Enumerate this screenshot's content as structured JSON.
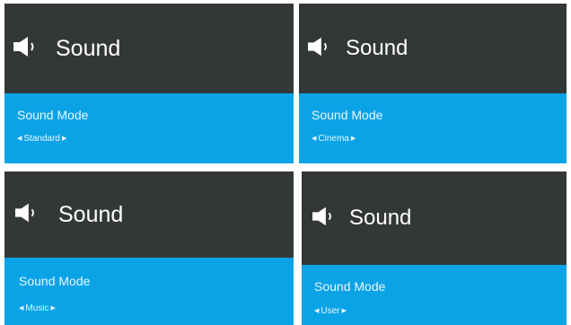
{
  "panels": [
    {
      "title": "Sound",
      "mode_label": "Sound Mode",
      "value": "Standard",
      "left_arrow": "◀",
      "right_arrow": "▶",
      "icon": "speaker-icon"
    },
    {
      "title": "Sound",
      "mode_label": "Sound Mode",
      "value": "Cinema",
      "left_arrow": "◀",
      "right_arrow": "▶",
      "icon": "speaker-icon"
    },
    {
      "title": "Sound",
      "mode_label": "Sound Mode",
      "value": "Music",
      "left_arrow": "◀",
      "right_arrow": "▶",
      "icon": "speaker-icon"
    },
    {
      "title": "Sound",
      "mode_label": "Sound Mode",
      "value": "User",
      "left_arrow": "◀",
      "right_arrow": "▶",
      "icon": "speaker-icon"
    }
  ],
  "colors": {
    "header_bg": "#343737",
    "body_bg": "#0aa3e6",
    "text": "#ffffff"
  }
}
